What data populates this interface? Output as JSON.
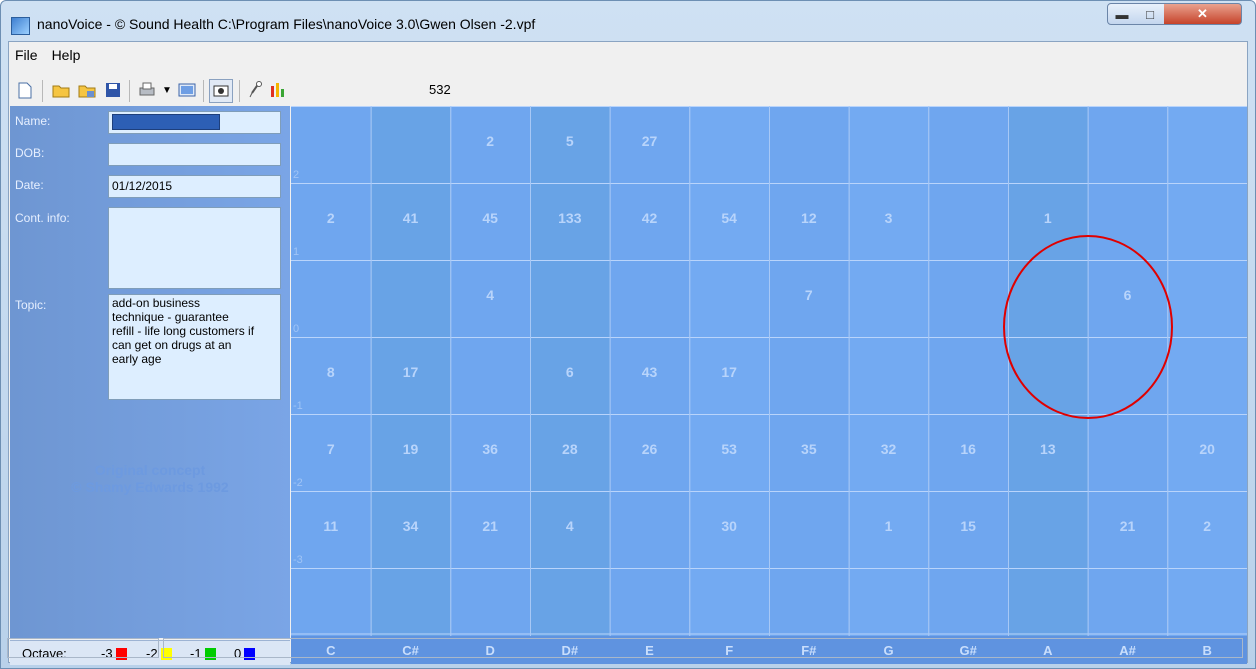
{
  "window": {
    "title": "nanoVoice - © Sound Health C:\\Program Files\\nanoVoice 3.0\\Gwen Olsen -2.vpf",
    "min_icon": "minimize-icon",
    "max_icon": "maximize-icon",
    "close_icon": "close-icon"
  },
  "menu": [
    "File",
    "Help"
  ],
  "toolbar": {
    "icons": [
      "new-file-icon",
      "open-folder-icon",
      "open-folder-2-icon",
      "save-icon",
      "print-icon",
      "dropdown-arrow-icon",
      "screen-icon",
      "record-icon",
      "microphone-icon",
      "bar-chart-icon"
    ],
    "count": "532"
  },
  "form": {
    "name_label": "Name:",
    "dob_label": "DOB:",
    "dob_value": "",
    "date_label": "Date:",
    "date_value": "01/12/2015",
    "cont_label": "Cont. info:",
    "cont_value": "",
    "topic_label": "Topic:",
    "topic_lines": [
      "add-on business",
      "technique - guarantee",
      "refill - life long customers if",
      "can get on drugs at an",
      "early age"
    ]
  },
  "credit": {
    "line1": "Original concept",
    "line2": "© Shamy Edwards 1992"
  },
  "octave_legend": {
    "label": "Octave:",
    "items": [
      {
        "text": "-3",
        "color": "#ff0000"
      },
      {
        "text": "-2",
        "color": "#ffff00"
      },
      {
        "text": "-1",
        "color": "#00cc00"
      },
      {
        "text": "0",
        "color": "#0000ff"
      }
    ]
  },
  "grid": {
    "notes": [
      "C",
      "C#",
      "D",
      "D#",
      "E",
      "F",
      "F#",
      "G",
      "G#",
      "A",
      "A#",
      "B"
    ],
    "row_labels": [
      "2",
      "1",
      "0",
      "-1",
      "-2",
      "-3"
    ],
    "rows": [
      [
        "",
        "",
        "2",
        "5",
        "27",
        "",
        "",
        "",
        "",
        "",
        "",
        ""
      ],
      [
        "2",
        "41",
        "45",
        "133",
        "42",
        "54",
        "12",
        "3",
        "",
        "1",
        "",
        ""
      ],
      [
        "",
        "",
        "4",
        "",
        "",
        "",
        "7",
        "",
        "",
        "",
        "6",
        ""
      ],
      [
        "8",
        "17",
        "",
        "6",
        "43",
        "17",
        "",
        "",
        "",
        "",
        "",
        ""
      ],
      [
        "7",
        "19",
        "36",
        "28",
        "26",
        "53",
        "35",
        "32",
        "16",
        "13",
        "",
        "20"
      ],
      [
        "11",
        "34",
        "21",
        "4",
        "",
        "30",
        "",
        "1",
        "15",
        "",
        "21",
        "2"
      ]
    ],
    "highlight_circle_color": "#e00000"
  }
}
